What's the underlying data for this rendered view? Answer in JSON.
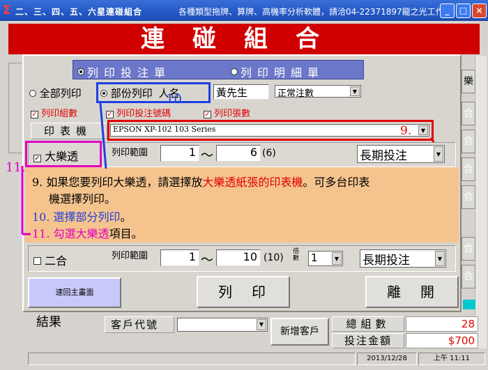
{
  "window": {
    "title": "二、三、四、五、六星連碰組合",
    "subtitle": "各種類型拖牌、算牌、高機率分析軟體，請洽04-22371897龍之光工作室",
    "min_label": "_",
    "max_label": "□",
    "close_label": "×"
  },
  "banner": {
    "text": "連碰組合"
  },
  "side_tabs": [
    "樂",
    "合",
    "合",
    "合",
    "合",
    "合",
    "合"
  ],
  "tabs": {
    "print_order": "列印投注單",
    "print_detail": "列印明細單"
  },
  "print_options": {
    "all_label": "全部列印",
    "partial_label": "部份列印",
    "name_label": "人名",
    "name_value": "黃先生",
    "bet_type_value": "正常注數",
    "chk_group": "列印組數",
    "chk_code": "列印投注號碼",
    "chk_sheets": "列印張數"
  },
  "printer": {
    "label": "印表機",
    "value": "EPSON XP-102 103 Series"
  },
  "lotto": {
    "label": "大樂透",
    "range_label": "列印範圍",
    "from": "1",
    "tilde": "～",
    "to": "6",
    "count": "(6)",
    "mode": "長期投注"
  },
  "erhe": {
    "label": "二合",
    "range_label": "列印範圍",
    "from": "1",
    "tilde": "～",
    "to": "10",
    "count": "(10)",
    "multiple_label": "倍數",
    "multiple_value": "1",
    "mode": "長期投注"
  },
  "annotations": {
    "n9": "9.",
    "n10": "10.",
    "n11": "11.",
    "line1_a": "9. 如果您要列印大樂透，請選擇放",
    "line1_b": "大樂透紙張的印表機",
    "line1_c": "。可多台印表",
    "line2": "機選擇列印。",
    "line3_a": "10. 選擇",
    "line3_b": "部分列印",
    "line3_c": "。",
    "line4_a": "11. 勾選",
    "line4_b": "大樂透",
    "line4_c": "項目。"
  },
  "buttons": {
    "back": "速回主畫面",
    "print": "列　印",
    "leave": "離　開"
  },
  "bottom": {
    "result": "結果",
    "customer_label": "客戶代號",
    "add_customer": "新增客戶",
    "total_groups_label": "總組數",
    "total_groups_value": "28",
    "bet_amount_label": "投注金額",
    "bet_amount_value": "$700",
    "date": "2013/12/28",
    "time": "上午 11:11"
  },
  "colors": {
    "annot_red": "#e00000",
    "annot_blue": "#1f3fe0",
    "annot_magenta": "#e000c0",
    "banner": "#d10000",
    "note_bg": "#f5c48e"
  }
}
